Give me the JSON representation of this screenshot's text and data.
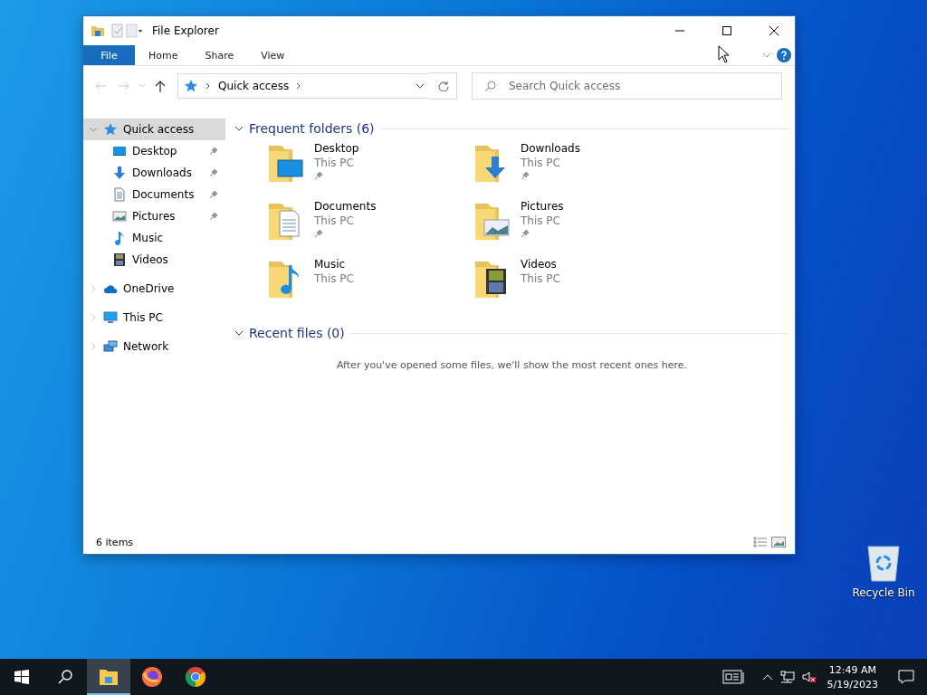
{
  "window": {
    "title": "File Explorer"
  },
  "ribbon_tabs": [
    {
      "label": "File",
      "selected": true
    },
    {
      "label": "Home",
      "selected": false
    },
    {
      "label": "Share",
      "selected": false
    },
    {
      "label": "View",
      "selected": false
    }
  ],
  "address": {
    "path": "Quick access"
  },
  "search": {
    "placeholder": "Search Quick access"
  },
  "nav": [
    {
      "label": "Quick access",
      "kind": "star",
      "selected": true,
      "expanded": true,
      "children": [
        {
          "label": "Desktop",
          "kind": "desktop",
          "pinned": true
        },
        {
          "label": "Downloads",
          "kind": "downloads",
          "pinned": true
        },
        {
          "label": "Documents",
          "kind": "documents",
          "pinned": true
        },
        {
          "label": "Pictures",
          "kind": "pictures",
          "pinned": true
        },
        {
          "label": "Music",
          "kind": "music",
          "pinned": false
        },
        {
          "label": "Videos",
          "kind": "videos",
          "pinned": false
        }
      ]
    },
    {
      "label": "OneDrive",
      "kind": "onedrive",
      "selected": false,
      "expanded": false
    },
    {
      "label": "This PC",
      "kind": "pc",
      "selected": false,
      "expanded": false
    },
    {
      "label": "Network",
      "kind": "network",
      "selected": false,
      "expanded": false
    }
  ],
  "frequent": {
    "heading": "Frequent folders (6)",
    "expanded": true,
    "folders": [
      {
        "name": "Desktop",
        "location": "This PC",
        "kind": "desktop",
        "pinned": true
      },
      {
        "name": "Downloads",
        "location": "This PC",
        "kind": "downloads",
        "pinned": true
      },
      {
        "name": "Documents",
        "location": "This PC",
        "kind": "documents",
        "pinned": true
      },
      {
        "name": "Pictures",
        "location": "This PC",
        "kind": "pictures",
        "pinned": true
      },
      {
        "name": "Music",
        "location": "This PC",
        "kind": "music",
        "pinned": false
      },
      {
        "name": "Videos",
        "location": "This PC",
        "kind": "videos",
        "pinned": false
      }
    ]
  },
  "recent": {
    "heading": "Recent files (0)",
    "expanded": true,
    "empty_message": "After you've opened some files, we'll show the most recent ones here."
  },
  "status_bar": {
    "items": "6 items"
  },
  "desktop_icons": [
    {
      "label": "Recycle Bin"
    }
  ],
  "taskbar": {
    "apps": [
      {
        "kind": "explorer",
        "selected": true
      },
      {
        "kind": "firefox",
        "selected": false
      },
      {
        "kind": "chrome",
        "selected": false
      }
    ],
    "time": "12:49 AM",
    "date": "5/19/2023"
  }
}
